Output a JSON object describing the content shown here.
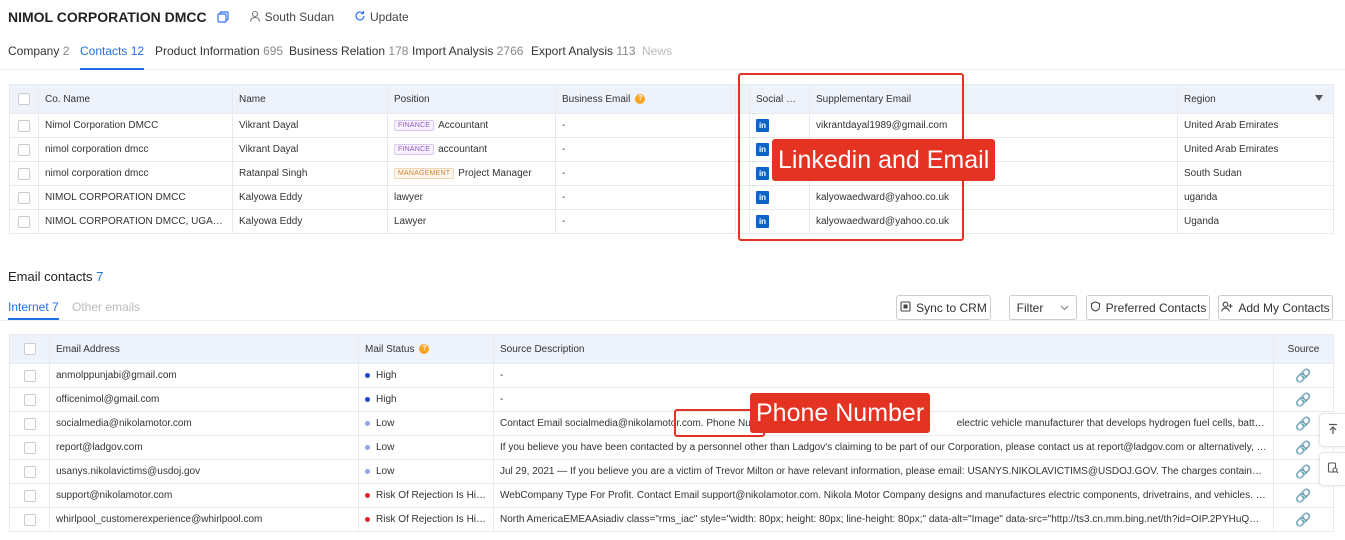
{
  "header": {
    "company_name": "NIMOL CORPORATION DMCC",
    "location": "South Sudan",
    "update_label": "Update"
  },
  "tabs": [
    {
      "label": "Company",
      "count": "2"
    },
    {
      "label": "Contacts",
      "count": "12"
    },
    {
      "label": "Product Information",
      "count": "695"
    },
    {
      "label": "Business Relation",
      "count": "178"
    },
    {
      "label": "Import Analysis",
      "count": "2766"
    },
    {
      "label": "Export Analysis",
      "count": "113"
    },
    {
      "label": "News",
      "count": ""
    }
  ],
  "contacts_table": {
    "columns": {
      "co_name": "Co. Name",
      "name": "Name",
      "position": "Position",
      "business_email": "Business Email",
      "social_media": "Social Me...",
      "supplementary_email": "Supplementary Email",
      "region": "Region"
    },
    "rows": [
      {
        "co_name": "Nimol Corporation DMCC",
        "name": "Vikrant Dayal",
        "tag": "FINANCE",
        "position": "Accountant",
        "business_email": "-",
        "linkedin": "in",
        "supplementary_email": "vikrantdayal1989@gmail.com",
        "region": "United Arab Emirates"
      },
      {
        "co_name": "nimol corporation dmcc",
        "name": "Vikrant Dayal",
        "tag": "FINANCE",
        "position": "accountant",
        "business_email": "-",
        "linkedin": "in",
        "supplementary_email": "",
        "region": "United Arab Emirates"
      },
      {
        "co_name": "nimol corporation dmcc",
        "name": "Ratanpal Singh",
        "tag": "MANAGEMENT",
        "position": "Project Manager",
        "business_email": "-",
        "linkedin": "in",
        "supplementary_email": "",
        "region": "South Sudan"
      },
      {
        "co_name": "NIMOL CORPORATION DMCC",
        "name": "Kalyowa Eddy",
        "tag": "",
        "position": "lawyer",
        "business_email": "-",
        "linkedin": "in",
        "supplementary_email": "kalyowaedward@yahoo.co.uk",
        "region": "uganda"
      },
      {
        "co_name": "NIMOL CORPORATION DMCC, UGANDA PRI...",
        "name": "Kalyowa Eddy",
        "tag": "",
        "position": "Lawyer",
        "business_email": "-",
        "linkedin": "in",
        "supplementary_email": "kalyowaedward@yahoo.co.uk",
        "region": "Uganda"
      }
    ]
  },
  "annotations": {
    "linkedin_email": "Linkedin and Email",
    "phone_number": "Phone Number"
  },
  "email_section": {
    "title": "Email contacts",
    "count": "7",
    "subtabs": [
      {
        "label": "Internet",
        "count": "7"
      },
      {
        "label": "Other emails",
        "count": ""
      }
    ],
    "buttons": {
      "sync": "Sync to CRM",
      "filter": "Filter",
      "preferred": "Preferred Contacts",
      "add": "Add My Contacts"
    },
    "columns": {
      "email": "Email Address",
      "status": "Mail Status",
      "description": "Source Description",
      "source": "Source"
    },
    "rows": [
      {
        "email": "anmolppunjabi@gmail.com",
        "status": "High",
        "status_type": "high",
        "description": "-"
      },
      {
        "email": "officenimol@gmail.com",
        "status": "High",
        "status_type": "high",
        "description": "-"
      },
      {
        "email": "socialmedia@nikolamotor.com",
        "status": "Low",
        "status_type": "low",
        "description": "Contact Email socialmedia@nikolamotor.com. Phone Number"
      },
      {
        "email": "report@ladgov.com",
        "status": "Low",
        "status_type": "low",
        "description": "If you believe you have been contacted by a personnel other than Ladgov's claiming to be part of our Corporation, please contact us at report@ladgov.com or alternatively, you may call us at..."
      },
      {
        "email": "usanys.nikolavictims@usdoj.gov",
        "status": "Low",
        "status_type": "low",
        "description": "Jul 29, 2021 — If you believe you are a victim of Trevor Milton or have relevant information, please email: USANYS.NIKOLAVICTIMS@USDOJ.GOV. The charges contained in the Indictment ..."
      },
      {
        "email": "support@nikolamotor.com",
        "status": "Risk Of Rejection Is High",
        "status_type": "risk",
        "description": "WebCompany Type For Profit. Contact Email support@nikolamotor.com. Nikola Motor Company designs and manufactures electric components, drivetrains, and vehicles. Nikola Motor ..."
      },
      {
        "email": "whirlpool_customerexperience@whirlpool.com",
        "status": "Risk Of Rejection Is High",
        "status_type": "risk",
        "description": "North AmericaEMEAAsiadiv class=\"rms_iac\" style=\"width: 80px; height: 80px; line-height: 80px;\" data-alt=\"Image\" data-src=\"http://ts3.cn.mm.bing.net/th?id=OIP.2PYHuQm_8GIgi74uW7de..."
      }
    ],
    "desc_tail_row3": "electric vehicle manufacturer that develops hydrogen fuel cells, battery electric ..."
  }
}
